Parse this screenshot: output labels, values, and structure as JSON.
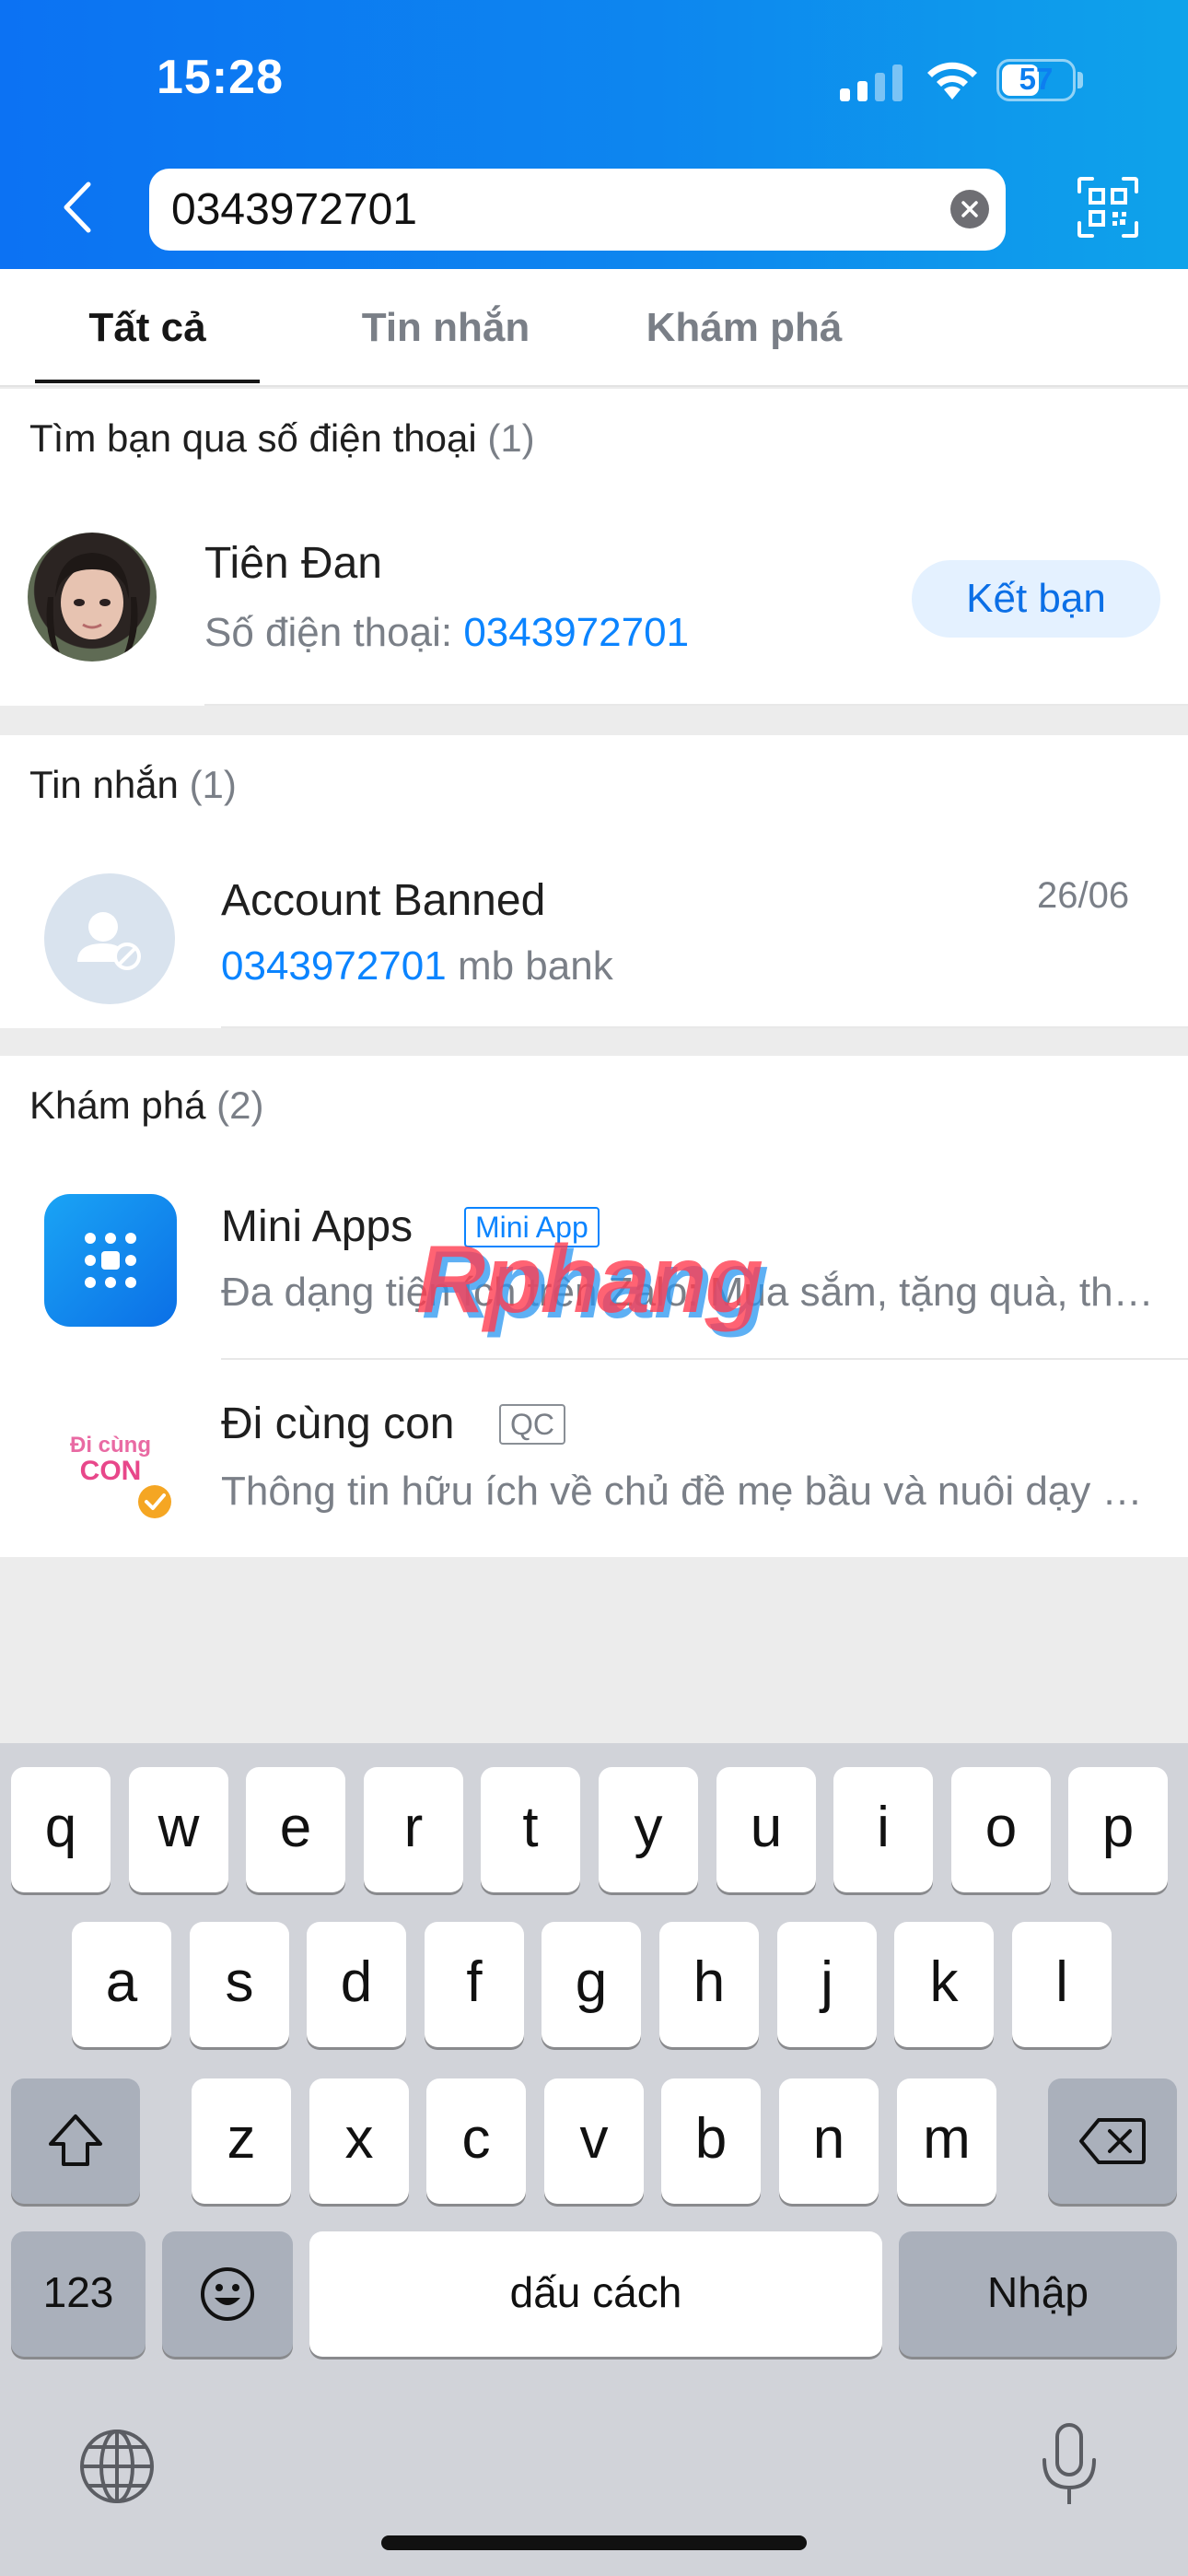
{
  "status_bar": {
    "time": "15:28",
    "battery": "57",
    "battery_level": 0.57
  },
  "search": {
    "value": "0343972701"
  },
  "tabs": [
    {
      "label": "Tất cả",
      "active": true
    },
    {
      "label": "Tin nhắn",
      "active": false
    },
    {
      "label": "Khám phá",
      "active": false
    }
  ],
  "phone_section": {
    "title": "Tìm bạn qua số điện thoại",
    "count": "(1)",
    "contact": {
      "name": "Tiên Đan",
      "phone_label": "Số điện thoại:",
      "phone": "0343972701",
      "button": "Kết bạn"
    }
  },
  "messages_section": {
    "title": "Tin nhắn",
    "count": "(1)",
    "item": {
      "name": "Account Banned",
      "date": "26/06",
      "highlight": "0343972701",
      "rest": "mb bank"
    }
  },
  "explore_section": {
    "title": "Khám phá",
    "count": "(2)",
    "items": [
      {
        "name": "Mini Apps",
        "badge": "Mini App",
        "desc": "Đa dạng tiện ích trên Zalo: Mua sắm, tặng quà, thanh toán..."
      },
      {
        "name": "Đi cùng con",
        "badge": "QC",
        "desc": "Thông tin hữu ích về chủ đề mẹ bầu và nuôi dạy con",
        "logo_line1": "Đi cùng",
        "logo_line2": "CON"
      }
    ]
  },
  "watermark": "Rphang",
  "keyboard": {
    "row1": [
      "q",
      "w",
      "e",
      "r",
      "t",
      "y",
      "u",
      "i",
      "o",
      "p"
    ],
    "row2": [
      "a",
      "s",
      "d",
      "f",
      "g",
      "h",
      "j",
      "k",
      "l"
    ],
    "row3": [
      "z",
      "x",
      "c",
      "v",
      "b",
      "n",
      "m"
    ],
    "numbers": "123",
    "space": "dấu cách",
    "enter": "Nhập"
  },
  "colors": {
    "accent": "#0b84ff",
    "header_start": "#0c72f3",
    "header_end": "#0ea3ea"
  }
}
